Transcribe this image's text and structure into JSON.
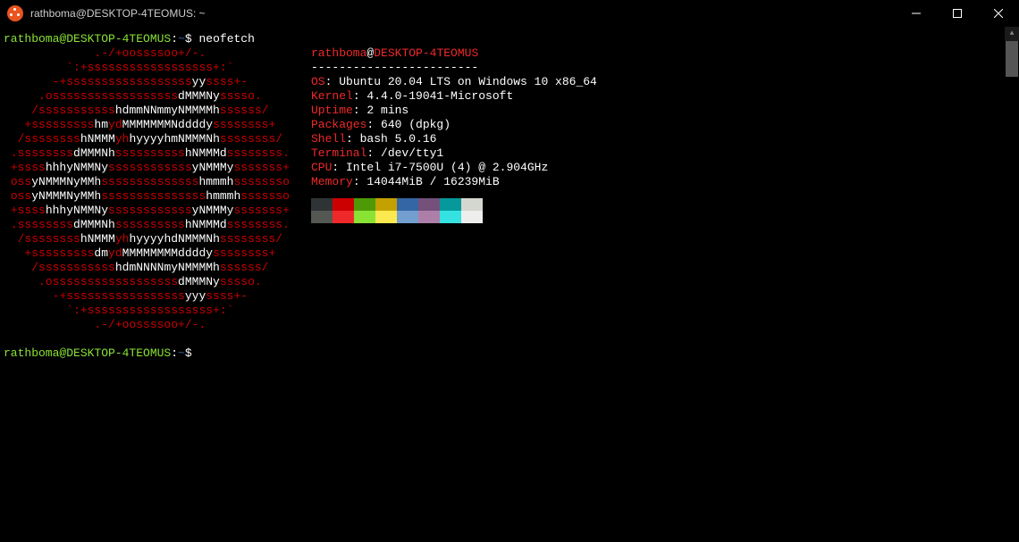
{
  "titlebar": {
    "title": "rathboma@DESKTOP-4TEOMUS: ~"
  },
  "prompt": {
    "user": "rathboma@DESKTOP-4TEOMUS",
    "colon": ":",
    "path": "~",
    "dollar": "$",
    "command": "neofetch"
  },
  "logo": [
    {
      "p": "             ",
      "r": ".-/+oossssoo+/-."
    },
    {
      "p": "         ",
      "r": "`:+ssssssssssssssssss+:`"
    },
    {
      "p": "       ",
      "r": "-+ssssssssssssssssss",
      "w": "yy",
      "r2": "ssss+-"
    },
    {
      "p": "     ",
      "r": ".ossssssssssssssssss",
      "w": "dMMMNy",
      "r2": "sssso."
    },
    {
      "p": "    ",
      "r": "/sssssssssss",
      "w": "hdmmNNmmyNMMMMh",
      "r2": "ssssss/"
    },
    {
      "p": "   ",
      "r": "+sssssssss",
      "w": "hm",
      "r2": "yd",
      "w2": "MMMMMMMNddddy",
      "r3": "ssssssss+"
    },
    {
      "p": "  ",
      "r": "/ssssssss",
      "w": "hNMMM",
      "r2": "yh",
      "w2": "hyyyyhmNMMMNh",
      "r3": "ssssssss/"
    },
    {
      "p": " ",
      "r": ".ssssssss",
      "w": "dMMMNh",
      "r2": "ssssssssss",
      "w2": "hNMMMd",
      "r3": "ssssssss."
    },
    {
      "p": " ",
      "r": "+ssss",
      "w": "hhhyNMMNy",
      "r2": "ssssssssssss",
      "w2": "yNMMMy",
      "r3": "sssssss+"
    },
    {
      "p": " ",
      "r": "oss",
      "w": "yNMMMNyMMh",
      "r2": "ssssssssssssss",
      "w2": "hmmmh",
      "r3": "ssssssso"
    },
    {
      "p": " ",
      "r": "oss",
      "w": "yNMMMNyMMh",
      "r2": "sssssssssssssss",
      "w2": "hmmmh",
      "r3": "sssssso"
    },
    {
      "p": " ",
      "r": "+ssss",
      "w": "hhhyNMMNy",
      "r2": "ssssssssssss",
      "w2": "yNMMMy",
      "r3": "sssssss+"
    },
    {
      "p": " ",
      "r": ".ssssssss",
      "w": "dMMMNh",
      "r2": "ssssssssss",
      "w2": "hNMMMd",
      "r3": "ssssssss."
    },
    {
      "p": "  ",
      "r": "/ssssssss",
      "w": "hNMMM",
      "r2": "yh",
      "w2": "hyyyyhdNMMMNh",
      "r3": "ssssssss/"
    },
    {
      "p": "   ",
      "r": "+sssssssss",
      "w": "dm",
      "r2": "yd",
      "w2": "MMMMMMMMddddy",
      "r3": "ssssssss+"
    },
    {
      "p": "    ",
      "r": "/sssssssssss",
      "w": "hdmNNNNmyNMMMMh",
      "r2": "ssssss/"
    },
    {
      "p": "     ",
      "r": ".ossssssssssssssssss",
      "w": "dMMMNy",
      "r2": "sssso."
    },
    {
      "p": "       ",
      "r": "-+sssssssssssssssss",
      "w": "yyy",
      "r2": "ssss+-"
    },
    {
      "p": "         ",
      "r": "`:+ssssssssssssssssss+:`"
    },
    {
      "p": "             ",
      "r": ".-/+oossssoo+/-."
    }
  ],
  "info": {
    "header_user": "rathboma",
    "header_at": "@",
    "header_host": "DESKTOP-4TEOMUS",
    "divider": "------------------------",
    "lines": [
      {
        "label": "OS",
        "value": ": Ubuntu 20.04 LTS on Windows 10 x86_64"
      },
      {
        "label": "Kernel",
        "value": ": 4.4.0-19041-Microsoft"
      },
      {
        "label": "Uptime",
        "value": ": 2 mins"
      },
      {
        "label": "Packages",
        "value": ": 640 (dpkg)"
      },
      {
        "label": "Shell",
        "value": ": bash 5.0.16"
      },
      {
        "label": "Terminal",
        "value": ": /dev/tty1"
      },
      {
        "label": "CPU",
        "value": ": Intel i7-7500U (4) @ 2.904GHz"
      },
      {
        "label": "Memory",
        "value": ": 14044MiB / 16239MiB"
      }
    ]
  }
}
